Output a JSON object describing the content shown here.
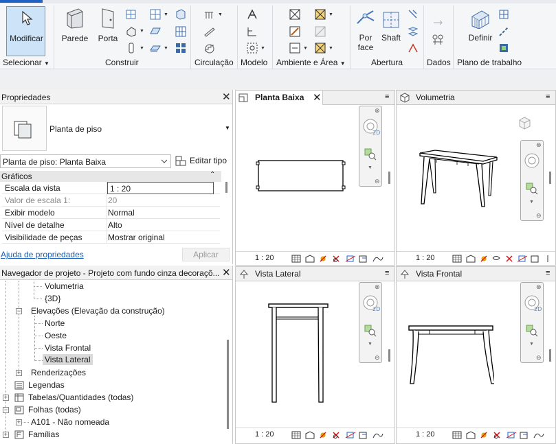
{
  "ribbon": {
    "buttons": {
      "modificar": "Modificar",
      "parede": "Parede",
      "porta": "Porta",
      "por_face_1": "Por",
      "por_face_2": "face",
      "shaft": "Shaft",
      "definir": "Definir"
    },
    "panels": {
      "selecionar": "Selecionar",
      "construir": "Construir",
      "circulacao": "Circulação",
      "modelo": "Modelo",
      "ambiente": "Ambiente e Área",
      "abertura": "Abertura",
      "dados": "Dados",
      "plano": "Plano de trabalho"
    }
  },
  "properties": {
    "title": "Propriedades",
    "type_name": "Planta de piso",
    "selector": "Planta de piso: Planta Baixa",
    "edit_type": "Editar tipo",
    "section": "Gráficos",
    "rows": [
      {
        "key": "Escala da vista",
        "value": "1 : 20"
      },
      {
        "key": "Valor de escala    1:",
        "value": "20"
      },
      {
        "key": "Exibir modelo",
        "value": "Normal"
      },
      {
        "key": "Nível de detalhe",
        "value": "Alto"
      },
      {
        "key": "Visibilidade de peças",
        "value": "Mostrar original"
      }
    ],
    "help_link": "Ajuda de propriedades",
    "apply": "Aplicar"
  },
  "browser": {
    "title": "Navegador de projeto - Projeto com fundo cinza decoraçõ...",
    "items": [
      "Volumetria",
      "{3D}",
      "Elevações (Elevação da construção)",
      "Norte",
      "Oeste",
      "Vista Frontal",
      "Vista Lateral",
      "Renderizações",
      "Legendas",
      "Tabelas/Quantidades (todas)",
      "Folhas (todas)",
      "A101 - Não nomeada",
      "Famílias"
    ]
  },
  "views": {
    "planta": {
      "title": "Planta Baixa",
      "scale": "1 : 20"
    },
    "volumetria": {
      "title": "Volumetria",
      "scale": "1 : 20"
    },
    "lateral": {
      "title": "Vista Lateral",
      "scale": "1 : 20"
    },
    "frontal": {
      "title": "Vista Frontal",
      "scale": "1 : 20"
    }
  },
  "navbar_label": "2D",
  "colors": {
    "accent": "#1f62c4",
    "selected_bg": "#cde3f7",
    "link": "#1a5fb4"
  }
}
